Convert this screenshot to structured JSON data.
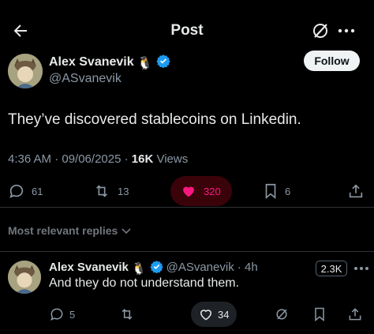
{
  "header": {
    "title": "Post",
    "back_icon": "arrow-left-icon",
    "grok_icon": "grok-icon",
    "more_icon": "more-horizontal-icon"
  },
  "post": {
    "author_name": "Alex Svanevik",
    "author_emoji": "🐧",
    "handle": "@ASvanevik",
    "follow_label": "Follow",
    "text": "They’ve discovered stablecoins on Linkedin.",
    "time": "4:36 AM · 09/06/2025 · ",
    "views_count": "16K",
    "views_label": " Views",
    "replies": "61",
    "reposts": "13",
    "likes": "320",
    "bookmarks": "6"
  },
  "replies_filter": {
    "label": "Most relevant replies"
  },
  "reply": {
    "author_name": "Alex Svanevik",
    "author_emoji": "🐧",
    "handle_time": "@ASvanevik · 4h",
    "badge": "2.3K",
    "text": "And they do not understand them.",
    "replies": "5",
    "likes": "34"
  },
  "colors": {
    "background": "#000000",
    "like_pink": "#f91880",
    "verified_blue": "#1d9bf0",
    "muted": "#8b98a5"
  }
}
